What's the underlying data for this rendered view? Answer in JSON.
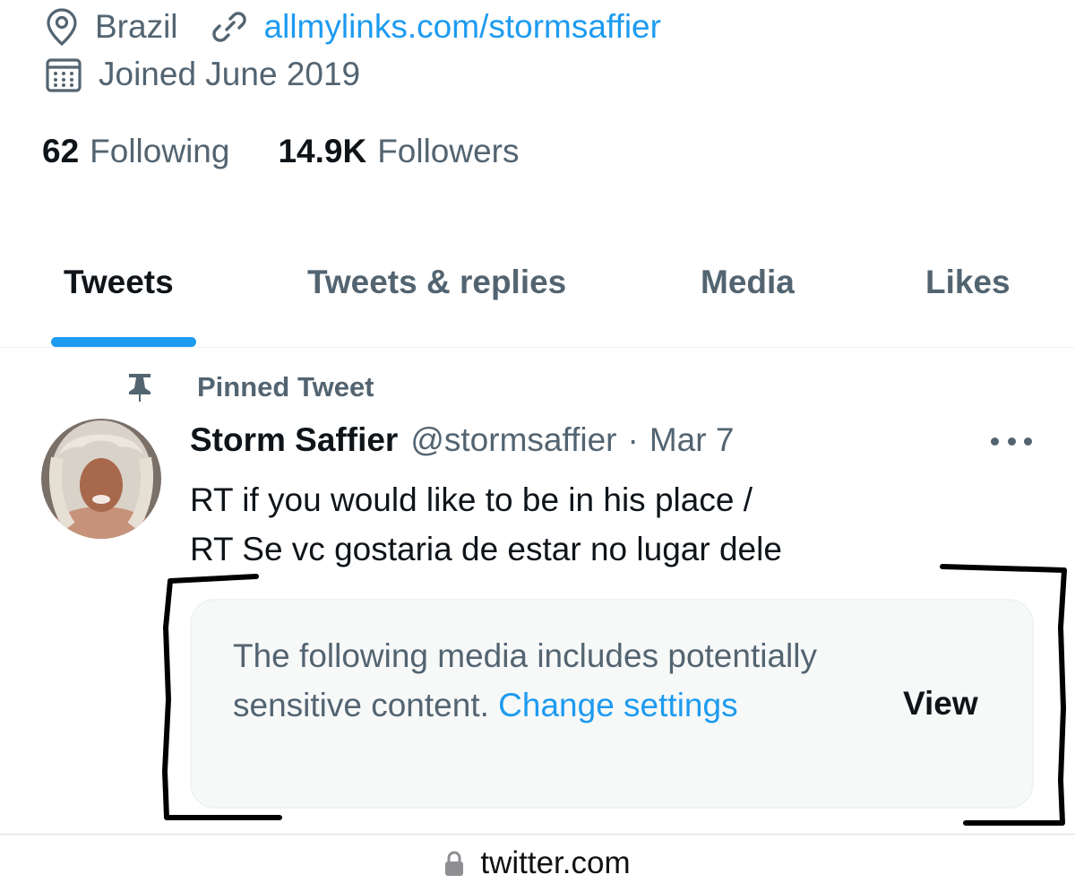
{
  "profile": {
    "location": "Brazil",
    "website": "allmylinks.com/stormsaffier",
    "joined": "Joined June 2019",
    "following_count": "62",
    "following_label": "Following",
    "followers_count": "14.9K",
    "followers_label": "Followers"
  },
  "tabs": [
    {
      "label": "Tweets",
      "active": true
    },
    {
      "label": "Tweets & replies",
      "active": false
    },
    {
      "label": "Media",
      "active": false
    },
    {
      "label": "Likes",
      "active": false
    }
  ],
  "tweet": {
    "pinned_label": "Pinned Tweet",
    "author_name": "Storm Saffier",
    "author_handle": "@stormsaffier",
    "separator": "·",
    "date": "Mar 7",
    "text_line1": "RT if you would like to be in his place /",
    "text_line2": "RT Se vc gostaria de estar no lugar dele",
    "sensitive_notice": "The following media includes potentially sensitive content.",
    "change_settings": "Change settings",
    "view_label": "View"
  },
  "browser": {
    "domain": "twitter.com"
  },
  "icons": {
    "location": "location-pin-icon",
    "link": "link-icon",
    "calendar": "calendar-icon",
    "pin": "pin-icon",
    "more": "more-dots-icon",
    "lock": "lock-icon"
  },
  "colors": {
    "accent": "#1d9bf0",
    "secondary_text": "#536471",
    "primary_text": "#0f1419",
    "notice_bg": "#f7f9f9"
  }
}
